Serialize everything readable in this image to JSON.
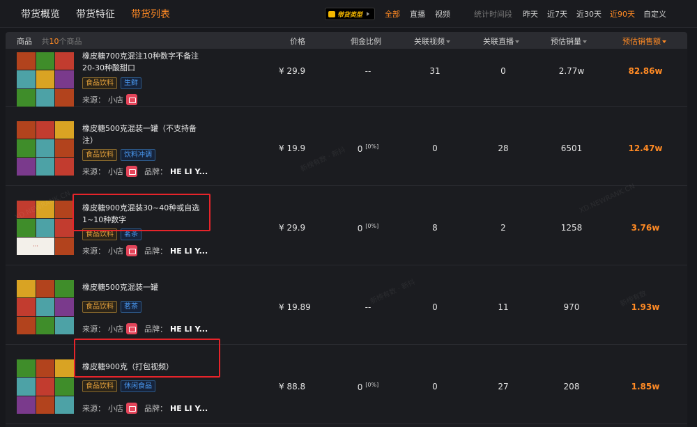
{
  "nav": {
    "tabs": [
      {
        "label": "带货概览",
        "active": false
      },
      {
        "label": "带货特征",
        "active": false
      },
      {
        "label": "带货列表",
        "active": true
      }
    ]
  },
  "filters": {
    "type_label": "带货类型",
    "channels": [
      {
        "label": "全部",
        "active": true
      },
      {
        "label": "直播",
        "active": false
      },
      {
        "label": "视频",
        "active": false
      }
    ],
    "time_label": "统计时间段",
    "times": [
      {
        "label": "昨天",
        "active": false
      },
      {
        "label": "近7天",
        "active": false
      },
      {
        "label": "近30天",
        "active": false
      },
      {
        "label": "近90天",
        "active": true
      },
      {
        "label": "自定义",
        "active": false
      }
    ]
  },
  "table": {
    "col_product": "商品",
    "count_prefix": "共",
    "count": "10",
    "count_suffix": "个商品",
    "col_price": "价格",
    "col_commission": "佣金比例",
    "col_videos": "关联视频",
    "col_lives": "关联直播",
    "col_sales": "预估销量",
    "col_gmv": "预估销售额",
    "source_label": "来源：",
    "brand_label": "品牌：",
    "rows": [
      {
        "title": "橡皮糖700克混注10种数字不备注20-30种酸甜口",
        "category": "食品饮料",
        "subcategory": "生鲜",
        "source": "小店",
        "brand": "",
        "price": "¥ 29.9",
        "commission": "--",
        "commission_pct": "",
        "videos": "31",
        "lives": "0",
        "sales": "2.77w",
        "gmv": "82.86w"
      },
      {
        "title": "橡皮糖500克混装一罐（不支持备注）",
        "category": "食品饮料",
        "subcategory": "饮料冲调",
        "source": "小店",
        "brand": "HE LI Y...",
        "price": "¥ 19.9",
        "commission": "0",
        "commission_pct": "[0%]",
        "videos": "0",
        "lives": "28",
        "sales": "6501",
        "gmv": "12.47w"
      },
      {
        "title": "橡皮糖900克混装30~40种或自选1~10种数字",
        "category": "食品饮料",
        "subcategory": "茗茶",
        "source": "小店",
        "brand": "HE LI Y...",
        "price": "¥ 29.9",
        "commission": "0",
        "commission_pct": "[0%]",
        "videos": "8",
        "lives": "2",
        "sales": "1258",
        "gmv": "3.76w"
      },
      {
        "title": "橡皮糖500克混装一罐",
        "category": "食品饮料",
        "subcategory": "茗茶",
        "source": "小店",
        "brand": "HE LI Y...",
        "price": "¥ 19.89",
        "commission": "--",
        "commission_pct": "",
        "videos": "0",
        "lives": "11",
        "sales": "970",
        "gmv": "1.93w"
      },
      {
        "title": "橡皮糖900克（打包视频）",
        "category": "食品饮料",
        "subcategory": "休闲食品",
        "source": "小店",
        "brand": "HE LI Y...",
        "price": "¥ 88.8",
        "commission": "0",
        "commission_pct": "[0%]",
        "videos": "0",
        "lives": "27",
        "sales": "208",
        "gmv": "1.85w"
      }
    ]
  },
  "watermarks": [
    "XD.NEWRANK.CN",
    "XD.NEWRANK.CN",
    "新榜有数 · 新抖",
    "新榜有数 · 新抖",
    "新榜有数"
  ],
  "colors": {
    "accent": "#ff8a24",
    "background": "#17181c",
    "highlight": "#e6242a",
    "tag_category": "#e6a23c",
    "tag_sub": "#4b9bf5"
  }
}
